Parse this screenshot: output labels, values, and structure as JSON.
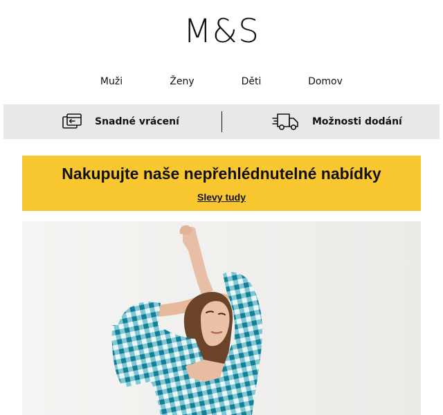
{
  "brand": {
    "logo_text": "M&S"
  },
  "nav": {
    "items": [
      {
        "label": "Muži"
      },
      {
        "label": "Ženy"
      },
      {
        "label": "Děti"
      },
      {
        "label": "Domov"
      }
    ]
  },
  "services": {
    "returns": {
      "label": "Snadné vrácení",
      "icon": "returns-card-icon"
    },
    "delivery": {
      "label": "Možnosti dodání",
      "icon": "delivery-truck-icon"
    }
  },
  "promo": {
    "title": "Nakupujte naše nepřehlédnutelné nabídky",
    "link": "Slevy tudy",
    "background_color": "#f9c72f"
  },
  "hero": {
    "image_subject": "woman-in-blue-gingham-dress-photo"
  }
}
